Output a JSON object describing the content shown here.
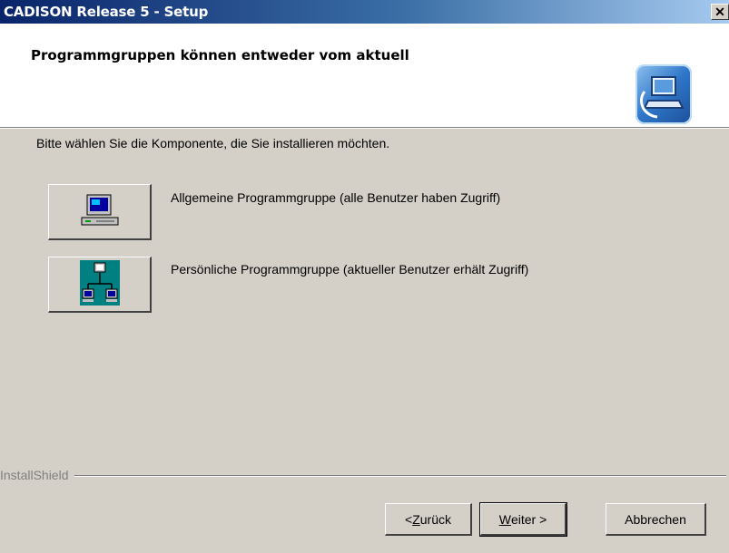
{
  "window": {
    "title": "CADISON Release 5 - Setup",
    "close_label": "✕"
  },
  "header": {
    "title": "Programmgruppen können entweder vom aktuell"
  },
  "prompt": "Bitte wählen Sie die Komponente, die Sie installieren möchten.",
  "options": [
    {
      "label": "Allgemeine Programmgruppe (alle Benutzer haben Zugriff)",
      "icon": "computer-icon"
    },
    {
      "label": "Persönliche Programmgruppe (aktueller Benutzer erhält Zugriff)",
      "icon": "network-icon"
    }
  ],
  "footer": {
    "brand": "InstallShield",
    "back_prefix": "< ",
    "back_mnemonic": "Z",
    "back_rest": "urück",
    "next_mnemonic": "W",
    "next_rest": "eiter >",
    "cancel_label": "Abbrechen"
  }
}
